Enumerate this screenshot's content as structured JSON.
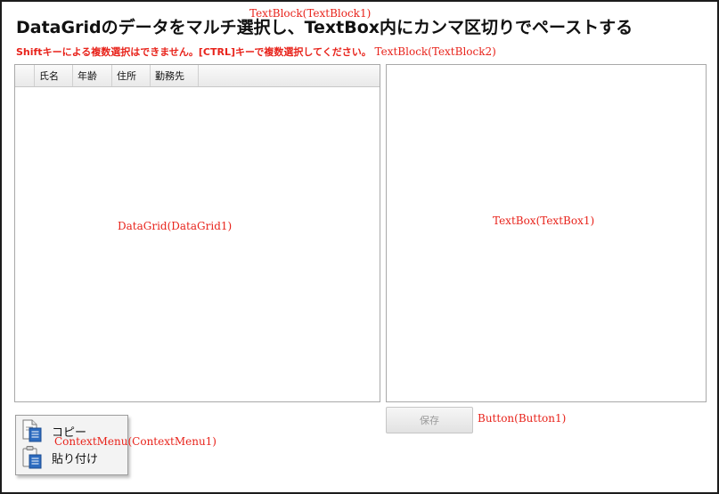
{
  "title": "DataGridのデータをマルチ選択し、TextBox内にカンマ区切りでペーストする",
  "subtitle": "Shiftキーによる複数選択はできません。[CTRL]キーで複数選択してください。",
  "annotations": {
    "textblock1": "TextBlock(TextBlock1)",
    "textblock2": "TextBlock(TextBlock2)",
    "datagrid": "DataGrid(DataGrid1)",
    "textbox": "TextBox(TextBox1)",
    "button": "Button(Button1)",
    "contextmenu": "ContextMenu(ContextMenu1)"
  },
  "datagrid": {
    "columns": [
      "氏名",
      "年齢",
      "住所",
      "勤務先"
    ]
  },
  "textbox": {
    "value": ""
  },
  "button": {
    "label": "保存"
  },
  "context_menu": {
    "items": [
      {
        "label": "コピー",
        "icon": "copy-icon"
      },
      {
        "label": "貼り付け",
        "icon": "paste-icon"
      }
    ]
  },
  "colors": {
    "annotation": "#e8231b",
    "border": "#a9a9a9",
    "window_border": "#1c1c1c"
  }
}
